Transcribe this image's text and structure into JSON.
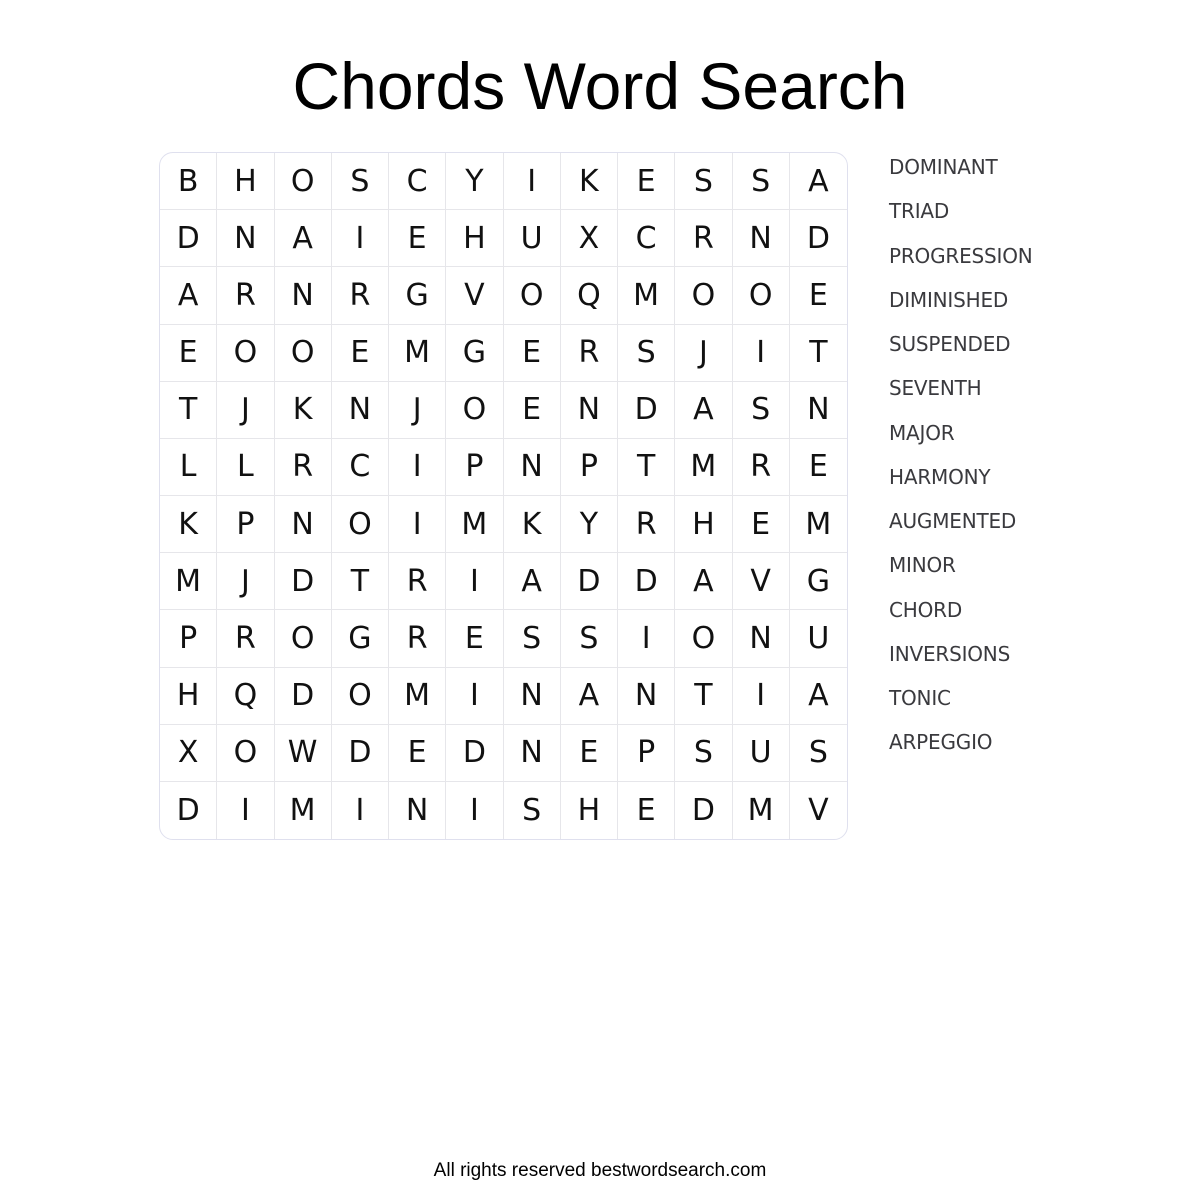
{
  "title": "Chords Word Search",
  "grid": [
    [
      "B",
      "H",
      "O",
      "S",
      "C",
      "Y",
      "I",
      "K",
      "E",
      "S",
      "S",
      "A"
    ],
    [
      "D",
      "N",
      "A",
      "I",
      "E",
      "H",
      "U",
      "X",
      "C",
      "R",
      "N",
      "D"
    ],
    [
      "A",
      "R",
      "N",
      "R",
      "G",
      "V",
      "O",
      "Q",
      "M",
      "O",
      "O",
      "E"
    ],
    [
      "E",
      "O",
      "O",
      "E",
      "M",
      "G",
      "E",
      "R",
      "S",
      "J",
      "I",
      "T"
    ],
    [
      "T",
      "J",
      "K",
      "N",
      "J",
      "O",
      "E",
      "N",
      "D",
      "A",
      "S",
      "N"
    ],
    [
      "L",
      "L",
      "R",
      "C",
      "I",
      "P",
      "N",
      "P",
      "T",
      "M",
      "R",
      "E"
    ],
    [
      "K",
      "P",
      "N",
      "O",
      "I",
      "M",
      "K",
      "Y",
      "R",
      "H",
      "E",
      "M"
    ],
    [
      "M",
      "J",
      "D",
      "T",
      "R",
      "I",
      "A",
      "D",
      "D",
      "A",
      "V",
      "G"
    ],
    [
      "P",
      "R",
      "O",
      "G",
      "R",
      "E",
      "S",
      "S",
      "I",
      "O",
      "N",
      "U"
    ],
    [
      "H",
      "Q",
      "D",
      "O",
      "M",
      "I",
      "N",
      "A",
      "N",
      "T",
      "I",
      "A"
    ],
    [
      "X",
      "O",
      "W",
      "D",
      "E",
      "D",
      "N",
      "E",
      "P",
      "S",
      "U",
      "S"
    ],
    [
      "D",
      "I",
      "M",
      "I",
      "N",
      "I",
      "S",
      "H",
      "E",
      "D",
      "M",
      "V"
    ]
  ],
  "words": [
    "DOMINANT",
    "TRIAD",
    "PROGRESSION",
    "DIMINISHED",
    "SUSPENDED",
    "SEVENTH",
    "MAJOR",
    "HARMONY",
    "AUGMENTED",
    "MINOR",
    "CHORD",
    "INVERSIONS",
    "TONIC",
    "ARPEGGIO"
  ],
  "footer": "All rights reserved bestwordsearch.com"
}
